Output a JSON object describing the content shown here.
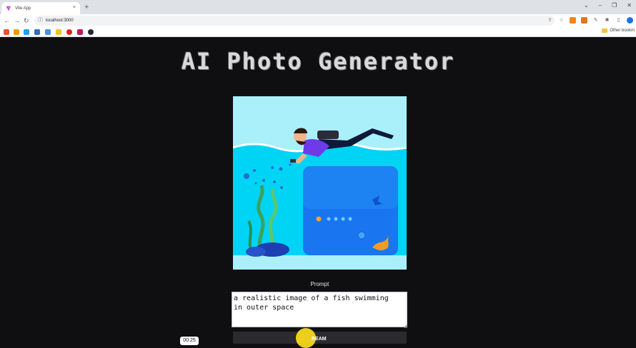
{
  "browser": {
    "tab_title": "Vite App",
    "tab_close": "×",
    "new_tab": "+",
    "url": "localhost:3000",
    "other_bookmarks": "Other bookm"
  },
  "page": {
    "title": "AI Photo Generator",
    "image_alt": "Illustration of a scuba diver swimming over underwater scene",
    "prompt_label": "Prompt",
    "prompt_value": "a realistic image of a fish swimming\nin outer space",
    "generate_label": "REAM"
  },
  "overlay": {
    "timer": "00:25"
  },
  "colors": {
    "page_bg": "#0f0f12",
    "button_bg": "#2b2b2f",
    "water": "#00d4f5",
    "cursor_highlight": "#f7d81b"
  }
}
